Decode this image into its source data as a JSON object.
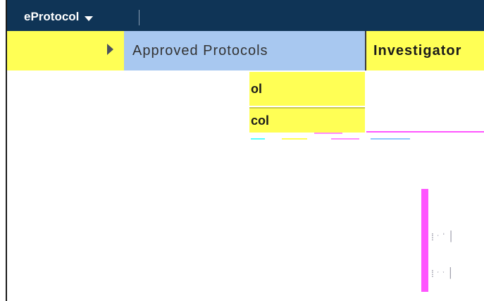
{
  "nav": {
    "app_menu_label": "eProtocol",
    "selected_item": "Approved Protocols",
    "investigator_label": "Investigator",
    "submenu_items": [
      "ol",
      "col"
    ]
  }
}
